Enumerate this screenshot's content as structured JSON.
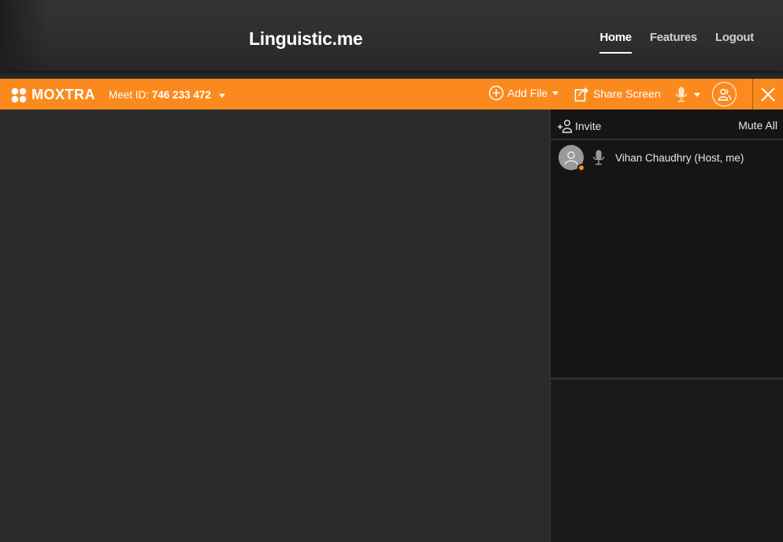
{
  "site": {
    "brand": "Linguistic.me",
    "nav": [
      {
        "label": "Home",
        "active": true
      },
      {
        "label": "Features",
        "active": false
      },
      {
        "label": "Logout",
        "active": false
      }
    ]
  },
  "meeting": {
    "logo_text": "MOXTRA",
    "meet_id_label": "Meet ID:",
    "meet_id": "746 233 472",
    "add_file_label": "Add File",
    "share_screen_label": "Share Screen",
    "accent_color": "#fb8a1e"
  },
  "panel": {
    "invite_label": "Invite",
    "mute_all_label": "Mute All",
    "participants": [
      {
        "name": "Vihan Chaudhry (Host, me)"
      }
    ]
  }
}
